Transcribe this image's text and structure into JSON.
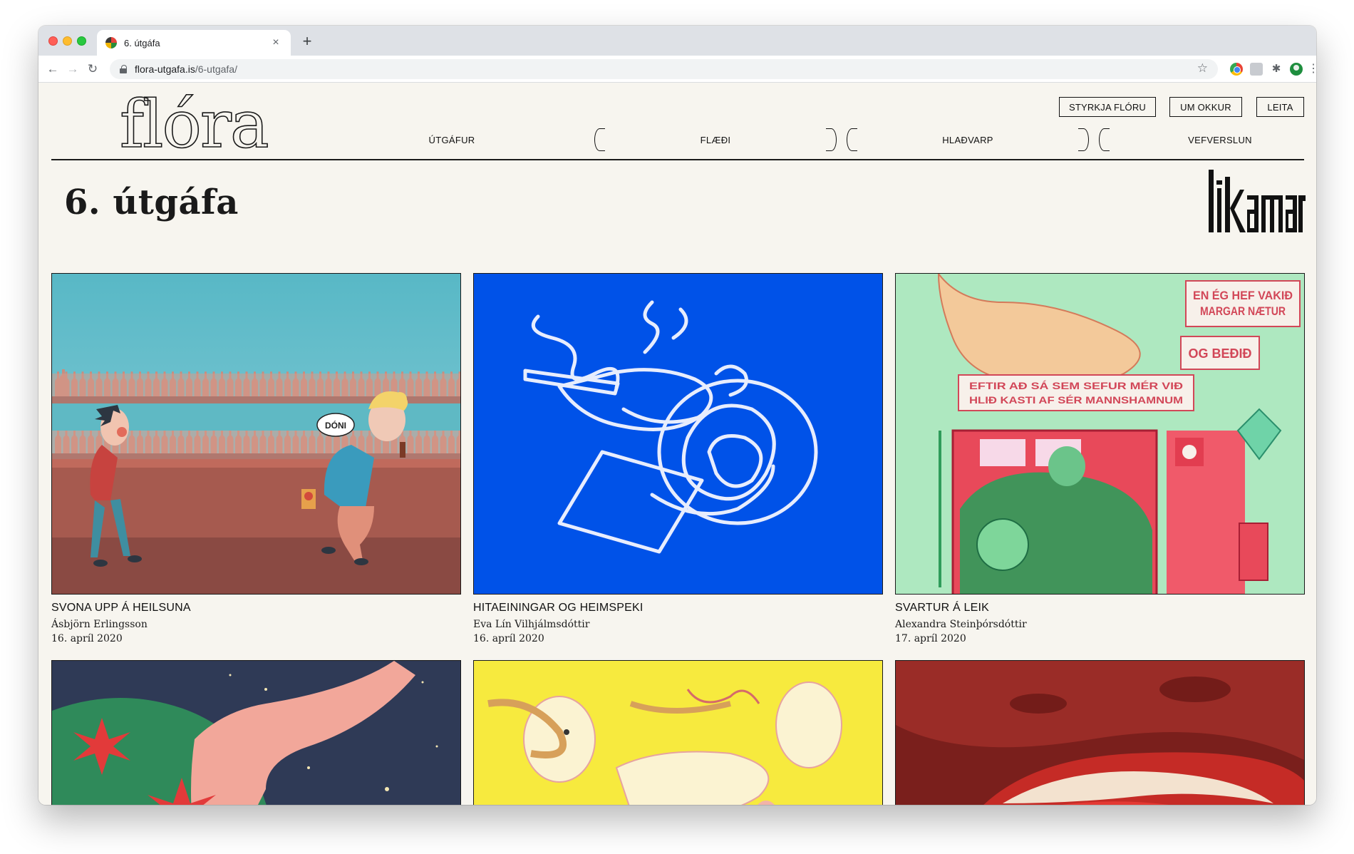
{
  "browser": {
    "tab_title": "6. útgáfa",
    "tab_close": "×",
    "new_tab": "+",
    "url_host": "flora-utgafa.is",
    "url_path": "/6-utgafa/",
    "icons": [
      "back-arrow-icon",
      "forward-arrow-icon",
      "reload-icon",
      "lock-icon",
      "star-icon",
      "extension-icon",
      "puzzle-icon",
      "profile-icon",
      "more-icon"
    ]
  },
  "site": {
    "logo": "flóra",
    "top_buttons": [
      "STYRKJA FLÓRU",
      "UM OKKUR",
      "LEITA"
    ],
    "nav": [
      "ÚTGÁFUR",
      "FLÆÐI",
      "HLAÐVARP",
      "VEFVERSLUN"
    ]
  },
  "page": {
    "title": "6. útgáfa",
    "issue_logo": "líkamar"
  },
  "articles": [
    {
      "title": "SVONA UPP Á HEILSUNA",
      "author": "Ásbjörn Erlingsson",
      "date": "16. apríl 2020",
      "speech_bubble": "DÓNI"
    },
    {
      "title": "HITAEININGAR OG HEIMSPEKI",
      "author": "Eva Lín Vilhjálmsdóttir",
      "date": "16. apríl 2020"
    },
    {
      "title": "SVARTUR Á LEIK",
      "author": "Alexandra Steinþórsdóttir",
      "date": "17. apríl 2020",
      "captions": [
        "EN ÉG HEF VAKIÐ MARGAR NÆTUR",
        "OG BEÐIÐ",
        "EFTIR AÐ SÁ SEM SEFUR MÉR VIÐ HLIÐ KASTI AF SÉR MANNSHAMNUM"
      ]
    },
    {
      "title": "",
      "author": "",
      "date": ""
    },
    {
      "title": "",
      "author": "",
      "date": ""
    },
    {
      "title": "",
      "author": "",
      "date": ""
    }
  ],
  "colors": {
    "page_bg": "#f7f5ef",
    "ink": "#1a1a1a",
    "blue_art": "#0052e8",
    "bar_sky": "#5ab9c6"
  }
}
